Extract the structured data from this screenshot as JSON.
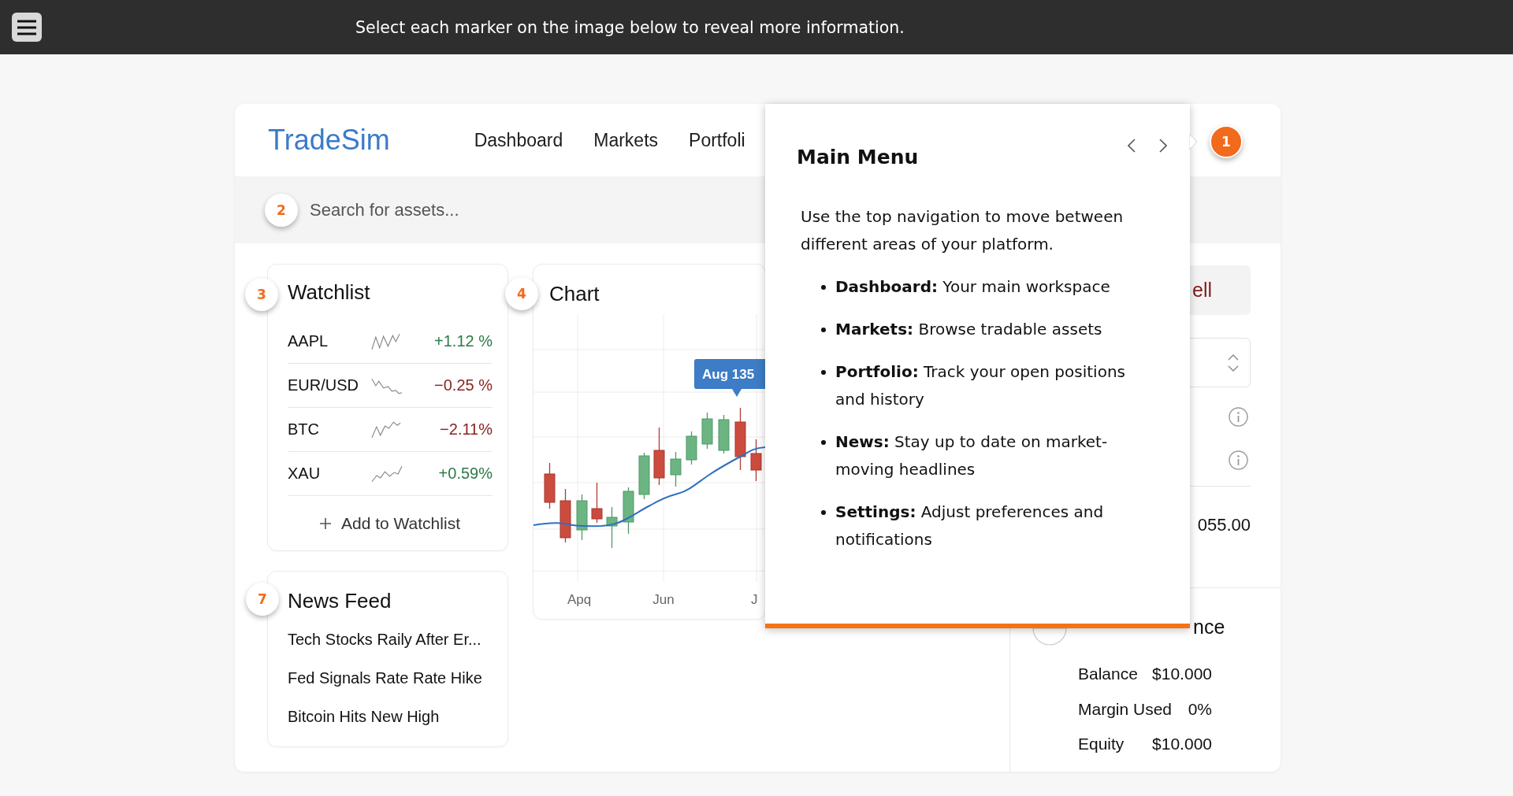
{
  "top_bar": {
    "instruction": "Select each marker on the image below to reveal more information."
  },
  "header": {
    "logo": "TradeSim",
    "nav": [
      {
        "label": "Dashboard"
      },
      {
        "label": "Markets"
      },
      {
        "label": "Portfoli"
      }
    ],
    "marker": {
      "number": "1",
      "selected": true
    }
  },
  "search": {
    "placeholder": "Search for assets...",
    "marker": {
      "number": "2",
      "selected": false
    }
  },
  "watchlist": {
    "title": "Watchlist",
    "marker": {
      "number": "3",
      "selected": false
    },
    "rows": [
      {
        "symbol": "AAPL",
        "change": "+1.12 %",
        "color": "#2c7a47"
      },
      {
        "symbol": "EUR/USD",
        "change": "−0.25 %",
        "color": "#8a2424"
      },
      {
        "symbol": "BTC",
        "change": "−2.11%",
        "color": "#8a2424"
      },
      {
        "symbol": "XAU",
        "change": "+0.59%",
        "color": "#2c7a47"
      }
    ],
    "add_button": "Add to Watchlist"
  },
  "chart": {
    "title": "Chart",
    "marker": {
      "number": "4",
      "selected": false
    },
    "tooltip": "Aug 135",
    "x_labels": [
      "Apq",
      "Jun",
      "J"
    ]
  },
  "news_feed": {
    "title": "News Feed",
    "marker": {
      "number": "7",
      "selected": false
    },
    "items": [
      "Tech Stocks Raily After Er...",
      "Fed Signals Rate Rate Hike",
      "Bitcoin Hits New High"
    ]
  },
  "order_panel": {
    "sell_button": "ell",
    "rows": [
      {
        "kind": "select"
      },
      {
        "kind": "info"
      },
      {
        "kind": "info"
      }
    ],
    "total": "055.00"
  },
  "account_balance": {
    "title": "nce",
    "marker": {
      "selected": false
    },
    "rows": [
      {
        "label": "Balance",
        "value": "$10.000"
      },
      {
        "label": "Margin Used",
        "value": "0%"
      },
      {
        "label": "Equity",
        "value": "$10.000"
      }
    ]
  },
  "popup": {
    "title": "Main Menu",
    "intro": "Use the top navigation to move between different areas of your platform.",
    "items": [
      "**Dashboard:** Your main workspace",
      "**Markets:** Browse tradable assets",
      "**Portfolio:** Track your open positions and history",
      "**News:** Stay up to date on market-moving headlines",
      "**Settings:** Adjust preferences and notifications"
    ]
  }
}
